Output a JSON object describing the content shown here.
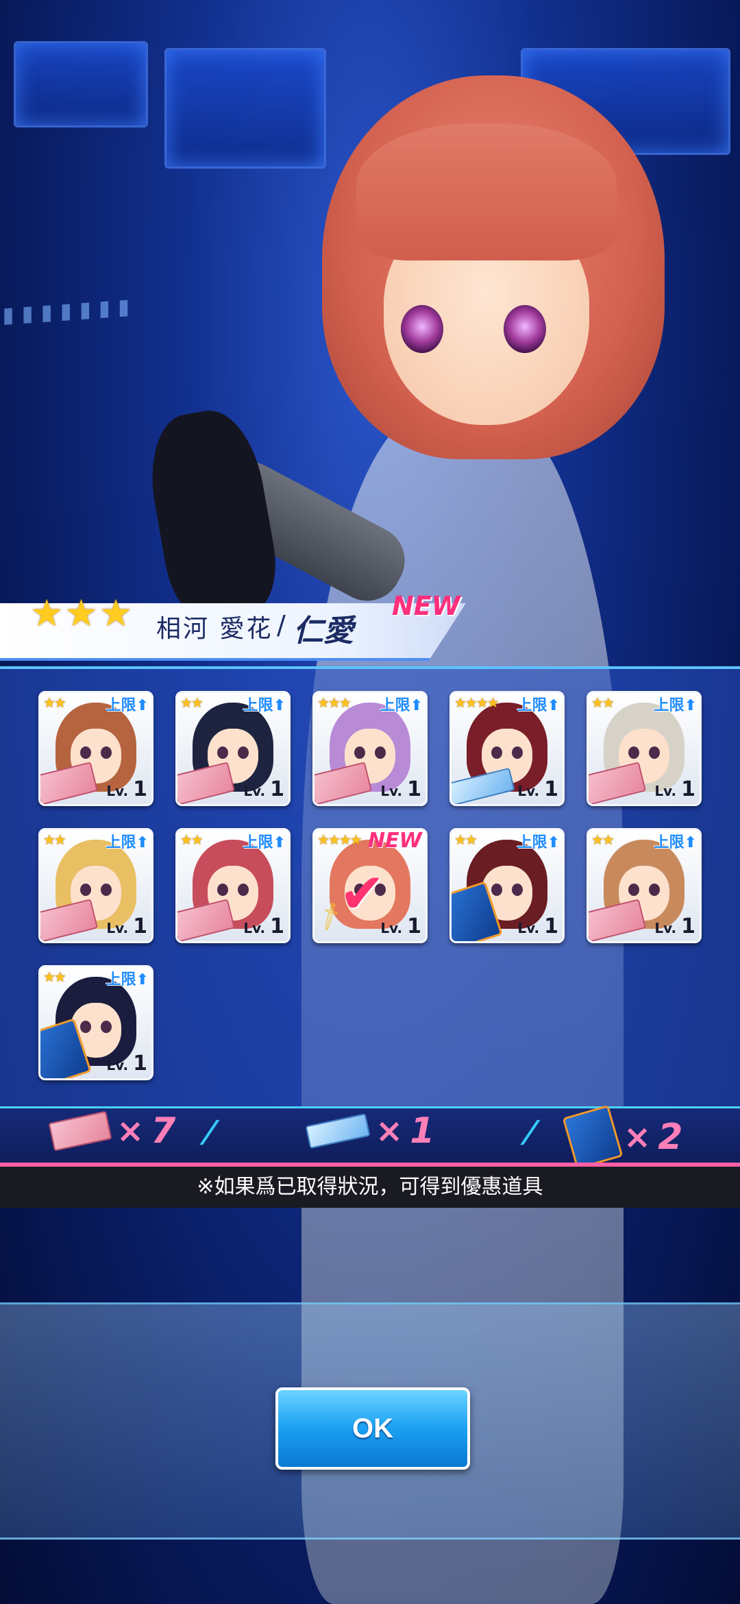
{
  "featured": {
    "stars": 3,
    "name": "相河 愛花",
    "separator": "/",
    "title": "仁愛",
    "new_label": "NEW"
  },
  "cards": [
    {
      "stars": 2,
      "limit_label": "上限",
      "level_label": "Lv.",
      "level": "1",
      "badge": "pink-ticket",
      "hair": "#b5643f"
    },
    {
      "stars": 2,
      "limit_label": "上限",
      "level_label": "Lv.",
      "level": "1",
      "badge": "pink-ticket",
      "hair": "#1e2440"
    },
    {
      "stars": 3,
      "limit_label": "上限",
      "level_label": "Lv.",
      "level": "1",
      "badge": "pink-ticket",
      "hair": "#b98ad6"
    },
    {
      "stars": 4,
      "limit_label": "上限",
      "level_label": "Lv.",
      "level": "1",
      "badge": "blue-ticket",
      "hair": "#7a1e2a"
    },
    {
      "stars": 2,
      "limit_label": "上限",
      "level_label": "Lv.",
      "level": "1",
      "badge": "pink-ticket",
      "hair": "#d7d2c8"
    },
    {
      "stars": 2,
      "limit_label": "上限",
      "level_label": "Lv.",
      "level": "1",
      "badge": "pink-ticket",
      "hair": "#e8bf63"
    },
    {
      "stars": 2,
      "limit_label": "上限",
      "level_label": "Lv.",
      "level": "1",
      "badge": "pink-ticket",
      "hair": "#c74d5c"
    },
    {
      "stars": 4,
      "limit_label": "上限",
      "level_label": "Lv.",
      "level": "1",
      "badge": "sword",
      "hair": "#e4775f",
      "new_label": "NEW",
      "checked": true
    },
    {
      "stars": 2,
      "limit_label": "上限",
      "level_label": "Lv.",
      "level": "1",
      "badge": "book",
      "hair": "#6a1d23"
    },
    {
      "stars": 2,
      "limit_label": "上限",
      "level_label": "Lv.",
      "level": "1",
      "badge": "pink-ticket",
      "hair": "#c88a5d"
    },
    {
      "stars": 2,
      "limit_label": "上限",
      "level_label": "Lv.",
      "level": "1",
      "badge": "book",
      "hair": "#1b1d3f"
    }
  ],
  "tally": [
    {
      "icon": "pink-ticket-icon",
      "times": "×",
      "count": "7"
    },
    {
      "icon": "blue-ticket-icon",
      "times": "×",
      "count": "1"
    },
    {
      "icon": "book-icon",
      "times": "×",
      "count": "2"
    }
  ],
  "note": "※如果爲已取得狀況，可得到優惠道具",
  "ok_label": "OK",
  "colors": {
    "accent": "#1aa0f2",
    "new": "#ff2f7d",
    "star": "#ffc21c"
  }
}
